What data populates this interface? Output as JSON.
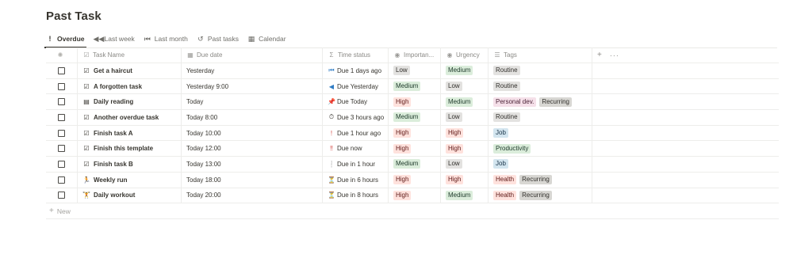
{
  "page": {
    "title": "Past Task"
  },
  "views": [
    {
      "label": "Overdue",
      "icon": "!",
      "icon_name": "exclamation-icon",
      "active": true
    },
    {
      "label": "Last week",
      "icon": "◀◀",
      "icon_name": "rewind-icon",
      "active": false
    },
    {
      "label": "Last month",
      "icon": "⏮",
      "icon_name": "skip-back-icon",
      "active": false
    },
    {
      "label": "Past tasks",
      "icon": "↺",
      "icon_name": "history-icon",
      "active": false
    },
    {
      "label": "Calendar",
      "icon": "▦",
      "icon_name": "calendar-icon",
      "active": false
    }
  ],
  "columns": {
    "task_name": {
      "label": "Task Name",
      "icon": "☑",
      "icon_name": "checkbox-icon"
    },
    "due_date": {
      "label": "Due date",
      "icon": "▦",
      "icon_name": "calendar-icon"
    },
    "time_status": {
      "label": "Time status",
      "icon": "Σ",
      "icon_name": "formula-icon"
    },
    "importance": {
      "label": "Importan...",
      "icon": "◉",
      "icon_name": "select-icon"
    },
    "urgency": {
      "label": "Urgency",
      "icon": "◉",
      "icon_name": "select-icon"
    },
    "tags": {
      "label": "Tags",
      "icon": "☰",
      "icon_name": "list-icon"
    },
    "add_label": "+",
    "more_label": "···"
  },
  "rows": [
    {
      "icon": "☑",
      "icon_name": "checkbox-icon",
      "name": "Get a haircut",
      "due": "Yesterday",
      "status_icon": "⏮",
      "status_icon_name": "skip-back-icon",
      "status_color": "#2f7cc4",
      "status": "Due 1 days ago",
      "importance": "Low",
      "urgency": "Medium",
      "tags": [
        "Routine"
      ]
    },
    {
      "icon": "☑",
      "icon_name": "checkbox-icon",
      "name": "A forgotten task",
      "due": "Yesterday 9:00",
      "status_icon": "◀",
      "status_icon_name": "rewind-icon",
      "status_color": "#2f7cc4",
      "status": "Due Yesterday",
      "importance": "Medium",
      "urgency": "Low",
      "tags": [
        "Routine"
      ]
    },
    {
      "icon": "▤",
      "icon_name": "book-icon",
      "name": "Daily reading",
      "due": "Today",
      "status_icon": "📌",
      "status_icon_name": "pin-icon",
      "status_color": "#d44c47",
      "status": "Due Today",
      "importance": "High",
      "urgency": "Medium",
      "tags": [
        "Personal dev.",
        "Recurring"
      ]
    },
    {
      "icon": "☑",
      "icon_name": "checkbox-icon",
      "name": "Another overdue task",
      "due": "Today 8:00",
      "status_icon": "⏱",
      "status_icon_name": "stopwatch-icon",
      "status_color": "#37352f",
      "status": "Due 3 hours ago",
      "importance": "Medium",
      "urgency": "Low",
      "tags": [
        "Routine"
      ]
    },
    {
      "icon": "☑",
      "icon_name": "checkbox-icon",
      "name": "Finish task A",
      "due": "Today 10:00",
      "status_icon": "!",
      "status_icon_name": "exclamation-icon",
      "status_color": "#d44c47",
      "status": "Due 1 hour ago",
      "importance": "High",
      "urgency": "High",
      "tags": [
        "Job"
      ]
    },
    {
      "icon": "☑",
      "icon_name": "checkbox-icon",
      "name": "Finish this template",
      "due": "Today 12:00",
      "status_icon": "‼",
      "status_icon_name": "double-exclamation-icon",
      "status_color": "#d44c47",
      "status": "Due now",
      "importance": "High",
      "urgency": "High",
      "tags": [
        "Productivity"
      ]
    },
    {
      "icon": "☑",
      "icon_name": "checkbox-icon",
      "name": "Finish task B",
      "due": "Today 13:00",
      "status_icon": "❕",
      "status_icon_name": "exclamation-icon",
      "status_color": "#d44c47",
      "status": "Due in 1 hour",
      "importance": "Medium",
      "urgency": "Low",
      "tags": [
        "Job"
      ]
    },
    {
      "icon": "🏃",
      "icon_name": "runner-icon",
      "name": "Weekly run",
      "due": "Today 18:00",
      "status_icon": "⏳",
      "status_icon_name": "hourglass-icon",
      "status_color": "#c29343",
      "status": "Due in 6 hours",
      "importance": "High",
      "urgency": "High",
      "tags": [
        "Health",
        "Recurring"
      ]
    },
    {
      "icon": "🏋",
      "icon_name": "dumbbell-icon",
      "name": "Daily workout",
      "due": "Today 20:00",
      "status_icon": "⏳",
      "status_icon_name": "hourglass-icon",
      "status_color": "#c29343",
      "status": "Due in 8 hours",
      "importance": "High",
      "urgency": "Medium",
      "tags": [
        "Health",
        "Recurring"
      ]
    }
  ],
  "new_row": {
    "icon": "+",
    "label": "New"
  },
  "pill_classes": {
    "Low": "p-low",
    "Medium": "p-medium",
    "High": "p-high",
    "Routine": "p-routine",
    "Recurring": "p-recurring",
    "Personal dev.": "p-personal",
    "Job": "p-job",
    "Productivity": "p-productivity",
    "Health": "p-health"
  }
}
